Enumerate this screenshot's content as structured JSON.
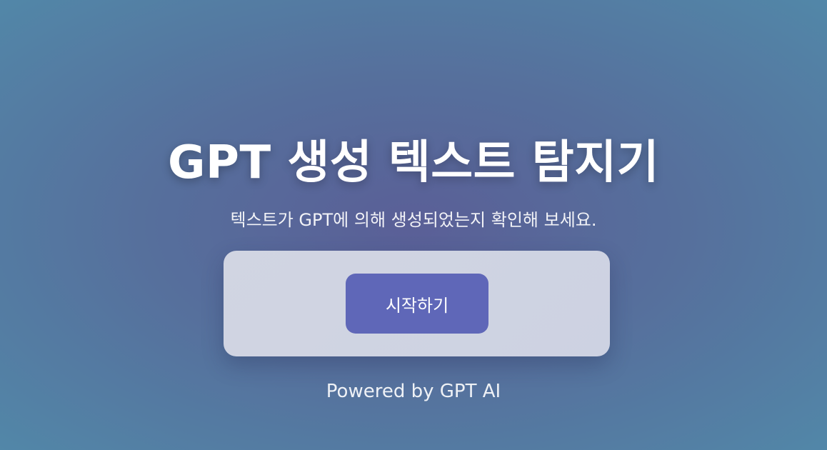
{
  "header": {
    "title": "GPT 생성 텍스트 탐지기",
    "subtitle": "텍스트가 GPT에 의해 생성되었는지 확인해 보세요."
  },
  "main": {
    "cta_label": "시작하기"
  },
  "footer": {
    "text": "Powered by GPT AI"
  },
  "colors": {
    "background_center": "#5a5f97",
    "background_edge": "#5287a8",
    "card": "#d1d5e2",
    "button": "#5f67b8",
    "text": "#ffffff"
  }
}
